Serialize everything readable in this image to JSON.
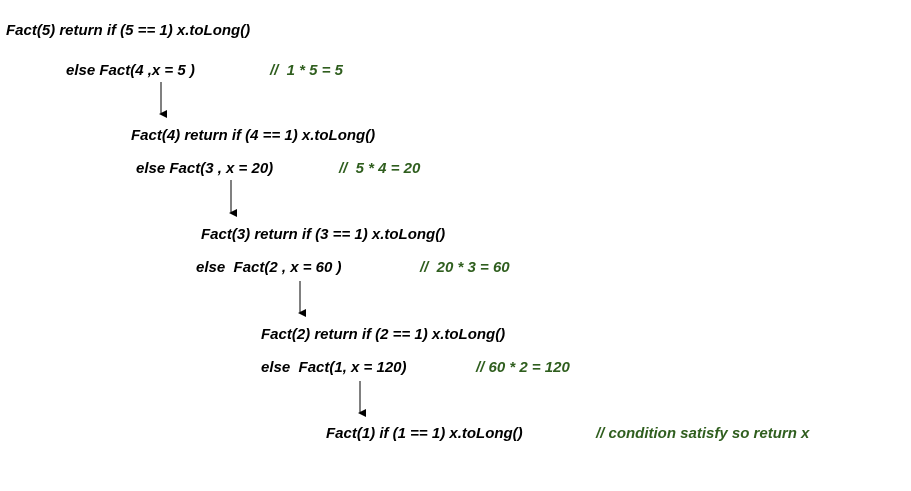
{
  "steps": [
    {
      "call": "Fact(5) return if (5 == 1) x.toLong()",
      "else": "else Fact(4 ,x = 5 )",
      "comment": "//  1 * 5 = 5"
    },
    {
      "call": "Fact(4) return if (4 == 1) x.toLong()",
      "else": "else Fact(3 , x = 20)",
      "comment": "//  5 * 4 = 20"
    },
    {
      "call": "Fact(3) return if (3 == 1) x.toLong()",
      "else": "else  Fact(2 , x = 60 )",
      "comment": "//  20 * 3 = 60"
    },
    {
      "call": "Fact(2) return if (2 == 1) x.toLong()",
      "else": "else  Fact(1, x = 120)",
      "comment": "// 60 * 2 = 120"
    }
  ],
  "final": {
    "call": "Fact(1) if (1 == 1) x.toLong()",
    "comment": "// condition satisfy so return x"
  },
  "colors": {
    "text": "#000000",
    "comment": "#2f5e1e"
  }
}
